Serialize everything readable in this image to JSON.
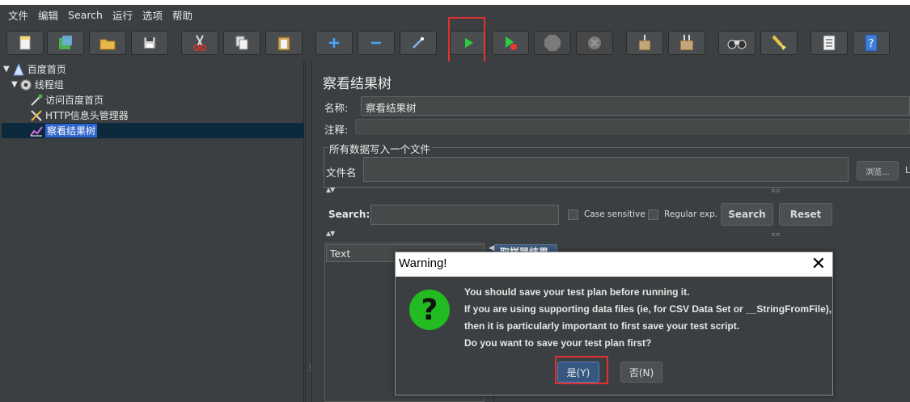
{
  "menu": {
    "items": [
      "文件",
      "编辑",
      "Search",
      "运行",
      "选项",
      "帮助"
    ]
  },
  "toolbar": {
    "buttons": [
      {
        "name": "new",
        "icon": "new-file-icon"
      },
      {
        "name": "templates",
        "icon": "templates-icon"
      },
      {
        "name": "open",
        "icon": "open-folder-icon"
      },
      {
        "name": "save",
        "icon": "save-disk-icon"
      },
      {
        "name": "cut",
        "icon": "scissors-icon"
      },
      {
        "name": "copy",
        "icon": "copy-icon"
      },
      {
        "name": "paste",
        "icon": "paste-icon"
      },
      {
        "name": "expand",
        "icon": "plus-icon"
      },
      {
        "name": "collapse",
        "icon": "minus-icon"
      },
      {
        "name": "toggle",
        "icon": "wand-icon"
      },
      {
        "name": "start",
        "icon": "play-icon"
      },
      {
        "name": "start-no-pauses",
        "icon": "play-no-timers-icon"
      },
      {
        "name": "stop",
        "icon": "stop-icon"
      },
      {
        "name": "shutdown",
        "icon": "shutdown-icon"
      },
      {
        "name": "clear",
        "icon": "broom-icon"
      },
      {
        "name": "clear-all",
        "icon": "broom-all-icon"
      },
      {
        "name": "search",
        "icon": "binoculars-icon"
      },
      {
        "name": "reset-search",
        "icon": "reset-search-icon"
      },
      {
        "name": "function-helper",
        "icon": "list-icon"
      },
      {
        "name": "help",
        "icon": "help-icon"
      }
    ]
  },
  "tree": {
    "nodes": [
      {
        "label": "百度首页",
        "icon": "test-plan-icon"
      },
      {
        "label": "线程组",
        "icon": "gear-icon"
      },
      {
        "label": "访问百度首页",
        "icon": "pipette-icon"
      },
      {
        "label": "HTTP信息头管理器",
        "icon": "tools-icon"
      },
      {
        "label": "察看结果树",
        "icon": "chart-icon"
      }
    ]
  },
  "panel": {
    "title": "察看结果树",
    "name_label": "名称:",
    "name_value": "察看结果树",
    "comment_label": "注释:",
    "file_group_label": "所有数据写入一个文件",
    "file_label": "文件名",
    "browse_label": "浏览...",
    "trailing_label": "L",
    "search_label": "Search:",
    "case_sensitive_label": "Case sensitive",
    "regular_exp_label": "Regular exp.",
    "search_button": "Search",
    "reset_button": "Reset",
    "renderer_value": "Text",
    "sampler_tab": "取样器结果"
  },
  "dialog": {
    "title": "Warning!",
    "close": "✕",
    "lines": [
      "You should save your test plan before running it.",
      "If you are using supporting data files (ie, for CSV Data Set or __StringFromFile),",
      "then it is particularly important to first save your test script.",
      "Do you want to save your test plan first?"
    ],
    "yes_label": "是(Y)",
    "no_label": "否(N)"
  }
}
